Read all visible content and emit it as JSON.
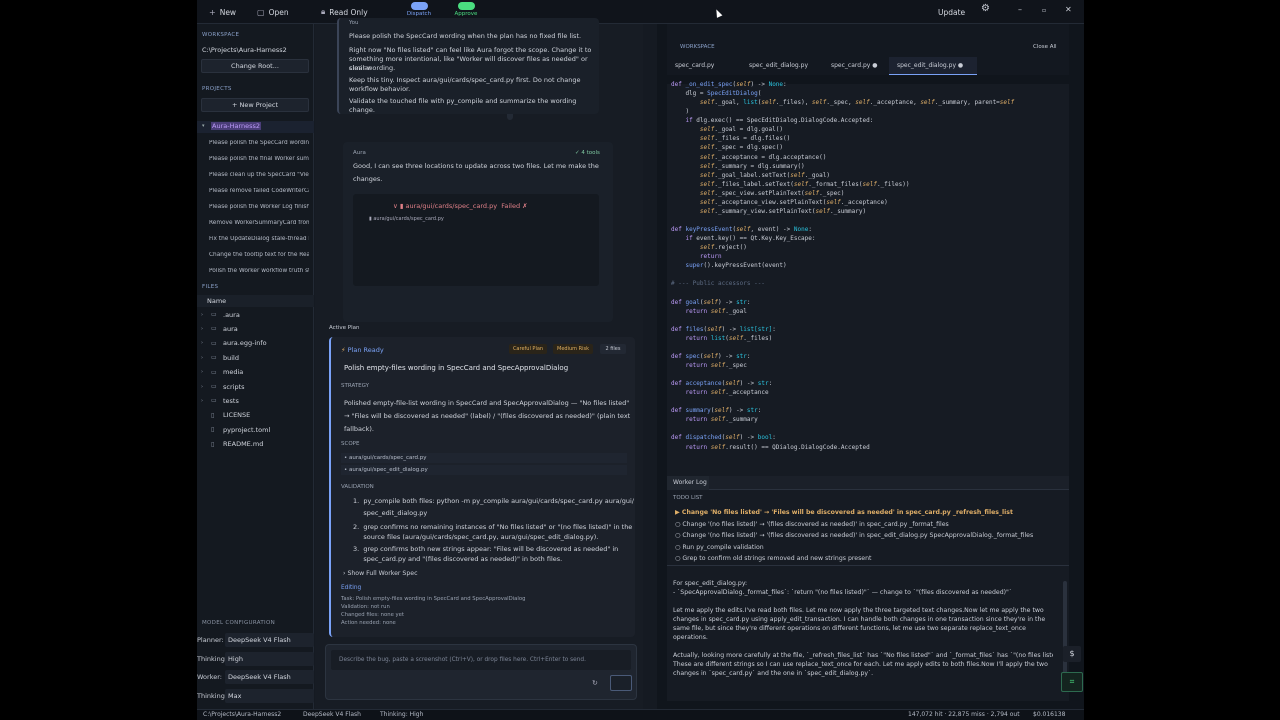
{
  "topbar": {
    "new_label": "New",
    "open_label": "Open",
    "readonly_label": "Read Only",
    "dispatch_label": "Dispatch",
    "approve_label": "Approve",
    "update_label": "Update",
    "dispatch_color": "#7aa2f7",
    "approve_color": "#4ade80"
  },
  "sidebar": {
    "workspace_title": "WORKSPACE",
    "workspace_path": "C:\\Projects\\Aura-Harness2",
    "change_root": "Change Root...",
    "projects_title": "PROJECTS",
    "new_project": "+ New Project",
    "project_root": "Aura-Harness2",
    "project_items": [
      "Please polish the SpecCard wording",
      "Please polish the final Worker summ",
      "Please clean up the SpecCard \"View",
      "Please remove failed CodeWriterCa",
      "Please polish the Worker Log finish",
      "Remove WorkerSummaryCard from",
      "Fix the UpdateDialog stale-thread b",
      "Change the tooltip text for the Reac",
      "Polish the Worker workflow truth st"
    ],
    "files_title": "FILES",
    "files_header": "Name",
    "files": [
      {
        "name": ".aura",
        "dir": true
      },
      {
        "name": "aura",
        "dir": true
      },
      {
        "name": "aura.egg-info",
        "dir": true
      },
      {
        "name": "build",
        "dir": true
      },
      {
        "name": "media",
        "dir": true
      },
      {
        "name": "scripts",
        "dir": true
      },
      {
        "name": "tests",
        "dir": true
      },
      {
        "name": "LICENSE",
        "dir": false
      },
      {
        "name": "pyproject.toml",
        "dir": false
      },
      {
        "name": "README.md",
        "dir": false
      }
    ],
    "model_config_title": "MODEL CONFIGURATION",
    "planner_label": "Planner:",
    "planner_value": "DeepSeek V4 Flash",
    "thinking_label": "Thinking:",
    "thinking_value": "High",
    "worker_label": "Worker:",
    "worker_value": "DeepSeek V4 Flash",
    "thinking2_label": "Thinking:",
    "thinking2_value": "Max"
  },
  "chat": {
    "user_label": "You",
    "user_lines": [
      "Please polish the SpecCard wording when the plan has no fixed file list.",
      "Right now \"No files listed\" can feel like Aura forgot the scope. Change it to",
      "something more intentional, like \"Worker will discover files as needed\" or similar",
      "clear wording.",
      "Keep this tiny. Inspect aura/gui/cards/spec_card.py first. Do not change",
      "workflow behavior.",
      "Validate the touched file with py_compile and summarize the wording change."
    ],
    "aura_label": "Aura",
    "tools_badge": "✓ 4 tools",
    "aura_lines": [
      "Good, I can see three locations to update across two files. Let me make the",
      "changes."
    ],
    "tool_file": "aura/gui/cards/spec_card.py",
    "tool_status": "Failed ✗",
    "tool_sub": "aura/gui/cards/spec_card.py",
    "active_plan_label": "Active Plan",
    "plan_ready": "Plan Ready",
    "badges": [
      "Careful Plan",
      "Medium Risk",
      "2 files"
    ],
    "plan_title": "Polish empty-files wording in SpecCard and SpecApprovalDialog",
    "strategy_title": "STRATEGY",
    "strategy_lines": [
      "Polished empty-file-list wording in SpecCard and SpecApprovalDialog — \"No files listed\"",
      "→ \"Files will be discovered as needed\" (label) / \"(files discovered as needed)\" (plain text",
      "fallback)."
    ],
    "scope_title": "SCOPE",
    "scope": [
      "• aura/gui/cards/spec_card.py",
      "• aura/gui/spec_edit_dialog.py"
    ],
    "validation_title": "VALIDATION",
    "validation_lines": [
      "1.  py_compile both files: python -m py_compile aura/gui/cards/spec_card.py aura/gui/",
      "     spec_edit_dialog.py",
      "2.  grep confirms no remaining instances of \"No files listed\" or \"(no files listed)\" in the",
      "     source files (aura/gui/cards/spec_card.py, aura/gui/spec_edit_dialog.py).",
      "3.  grep confirms both new strings appear: \"Files will be discovered as needed\" in",
      "     spec_card.py and \"(files discovered as needed)\" in both files."
    ],
    "show_full": "Show Full Worker Spec",
    "editing_label": "Editing",
    "editing_lines": [
      "Task: Polish empty-files wording in SpecCard and SpecApprovalDialog",
      "Validation: not run",
      "Changed files: none yet",
      "Action needed: none"
    ],
    "input_placeholder": "Describe the bug, paste a screenshot (Ctrl+V), or drop files here. Ctrl+Enter to send."
  },
  "editor": {
    "workspace_title": "WORKSPACE",
    "close_all": "Close All",
    "tabs": [
      "spec_card.py",
      "spec_edit_dialog.py",
      "spec_card.py ●",
      "spec_edit_dialog.py ●"
    ],
    "worker_log_tab": "Worker Log",
    "todo_title": "TODO LIST",
    "todos": [
      "▶ Change 'No files listed' → 'Files will be discovered as needed' in spec_card.py _refresh_files_list",
      "○ Change '(no files listed)' → '(files discovered as needed)' in spec_card.py _format_files",
      "○ Change '(no files listed)' → '(files discovered as needed)' in spec_edit_dialog.py SpecApprovalDialog._format_files",
      "○ Run py_compile validation",
      "○ Grep to confirm old strings removed and new strings present"
    ],
    "log_lines": [
      "For spec_edit_dialog.py:",
      "- `SpecApprovalDialog._format_files`: `return \"(no files listed)\"` — change to `\"(files discovered as needed)\"`",
      "",
      "Let me apply the edits.I've read both files. Let me now apply the three targeted text changes.Now let me apply the two",
      "changes in spec_card.py using apply_edit_transaction. I can handle both changes in one transaction since they're in the",
      "same file, but since they're different operations on different functions, let me use two separate replace_text_once",
      "operations.",
      "",
      "Actually, looking more carefully at the file, `_refresh_files_list` has `\"No files listed\"` and `_format_files` has `\"(no files listed)\"`.",
      "These are different strings so I can use replace_text_once for each. Let me apply edits to both files.Now I'll apply the two",
      "changes in `spec_card.py` and the one in `spec_edit_dialog.py`."
    ]
  },
  "status": {
    "path": "C:\\Projects\\Aura-Harness2",
    "model": "DeepSeek V4 Flash",
    "thinking": "Thinking: High",
    "tokens": "147,072 hit · 22,875 miss · 2,794 out",
    "cost": "$0.016138"
  }
}
